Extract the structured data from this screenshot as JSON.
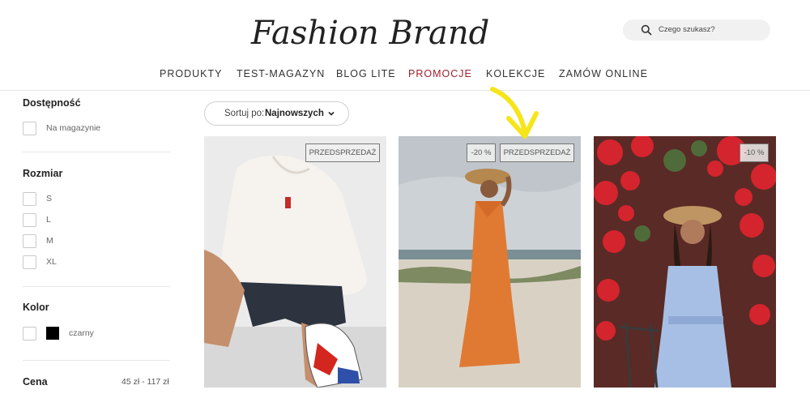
{
  "header": {
    "brand": "Fashion Brand",
    "search_placeholder": "Czego szukasz?"
  },
  "nav": {
    "items": [
      {
        "label": "PRODUKTY"
      },
      {
        "label": "TEST-MAGAZYN"
      },
      {
        "label": "BLOG LITE"
      },
      {
        "label": "PROMOCJE"
      },
      {
        "label": "KOLEKCJE"
      },
      {
        "label": "ZAMÓW ONLINE"
      }
    ]
  },
  "filters": {
    "availability": {
      "title": "Dostępność",
      "options": [
        "Na magazynie"
      ]
    },
    "size": {
      "title": "Rozmiar",
      "options": [
        "S",
        "L",
        "M",
        "XL"
      ]
    },
    "color": {
      "title": "Kolor",
      "options": [
        "czarny"
      ]
    },
    "price": {
      "title": "Cena",
      "range": "45 zł - 117 zł"
    }
  },
  "sort": {
    "label": "Sortuj po:",
    "value": "Najnowszych"
  },
  "products": [
    {
      "badges": [
        "PRZEDSPRZEDAŻ"
      ]
    },
    {
      "badges": [
        "-20 %",
        "PRZEDSPRZEDAŻ"
      ]
    },
    {
      "badges": [
        "-10 %"
      ]
    }
  ],
  "colors": {
    "accent": "#a11f2a",
    "annotation": "#f5e51a",
    "swatch_black": "#000000"
  }
}
